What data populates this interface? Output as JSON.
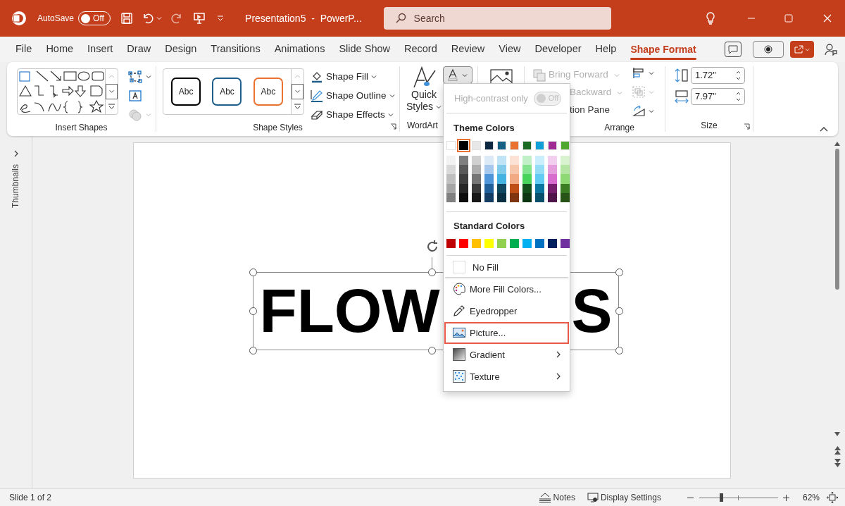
{
  "title_bar": {
    "autosave_label": "AutoSave",
    "autosave_on": false,
    "autosave_state": "Off",
    "document_title": "Presentation5  -  PowerP...",
    "search_placeholder": "Search"
  },
  "ribbon_tabs": [
    {
      "label": "File",
      "selected": false
    },
    {
      "label": "Home",
      "selected": false
    },
    {
      "label": "Insert",
      "selected": false
    },
    {
      "label": "Draw",
      "selected": false
    },
    {
      "label": "Design",
      "selected": false
    },
    {
      "label": "Transitions",
      "selected": false
    },
    {
      "label": "Animations",
      "selected": false
    },
    {
      "label": "Slide Show",
      "selected": false
    },
    {
      "label": "Record",
      "selected": false
    },
    {
      "label": "Review",
      "selected": false
    },
    {
      "label": "View",
      "selected": false
    },
    {
      "label": "Developer",
      "selected": false
    },
    {
      "label": "Help",
      "selected": false
    },
    {
      "label": "Shape Format",
      "selected": true
    }
  ],
  "ribbon": {
    "insert_shapes": {
      "label": "Insert Shapes"
    },
    "shape_styles": {
      "presets": [
        {
          "text": "Abc",
          "color": "#000000"
        },
        {
          "text": "Abc",
          "color": "#1f5f8b"
        },
        {
          "text": "Abc",
          "color": "#e97132"
        }
      ],
      "commands": [
        "Shape Fill",
        "Shape Outline",
        "Shape Effects"
      ],
      "label": "Shape Styles"
    },
    "wordart": {
      "quick_styles": "Quick Styles",
      "label": "WordArt"
    },
    "arrange": {
      "commands": [
        {
          "text": "Bring Forward",
          "disabled": true
        },
        {
          "text": "Backward",
          "disabled": true
        },
        {
          "text": "tion Pane",
          "disabled": false
        }
      ],
      "label": "Arrange"
    },
    "size": {
      "height": "1.72\"",
      "width": "7.97\"",
      "label": "Size"
    }
  },
  "thumbnails_pane": {
    "label": "Thumbnails"
  },
  "slide": {
    "text_left": "FLOW",
    "text_right": "S"
  },
  "fill_menu": {
    "high_contrast": {
      "label": "High-contrast only",
      "state": "Off",
      "on": false,
      "disabled": true
    },
    "theme_heading": "Theme Colors",
    "theme_colors": [
      {
        "color": "#ffffff",
        "selected": false,
        "shades": [
          {
            "color": "#f2f2f2"
          },
          {
            "color": "#d9d9d9"
          },
          {
            "color": "#bfbfbf"
          },
          {
            "color": "#a6a6a6"
          },
          {
            "color": "#808080"
          }
        ]
      },
      {
        "color": "#000000",
        "selected": true,
        "shades": [
          {
            "color": "#7f7f7f"
          },
          {
            "color": "#595959"
          },
          {
            "color": "#3f3f3f"
          },
          {
            "color": "#262626"
          },
          {
            "color": "#0d0d0d"
          }
        ]
      },
      {
        "color": "#e8e8e8",
        "selected": false,
        "shades": [
          {
            "color": "#d0d0d0"
          },
          {
            "color": "#aeaeae"
          },
          {
            "color": "#757575"
          },
          {
            "color": "#3a3a3a"
          },
          {
            "color": "#171717"
          }
        ]
      },
      {
        "color": "#0e2841",
        "selected": false,
        "shades": [
          {
            "color": "#dceaf7"
          },
          {
            "color": "#a6c8ed"
          },
          {
            "color": "#4e95d9"
          },
          {
            "color": "#215f9a"
          },
          {
            "color": "#153d63"
          }
        ]
      },
      {
        "color": "#156082",
        "selected": false,
        "shades": [
          {
            "color": "#c0e4f5"
          },
          {
            "color": "#83cbeb"
          },
          {
            "color": "#44b3e1"
          },
          {
            "color": "#104862"
          },
          {
            "color": "#0b3041"
          }
        ]
      },
      {
        "color": "#e97132",
        "selected": false,
        "shades": [
          {
            "color": "#fbe2d5"
          },
          {
            "color": "#f7c7ac"
          },
          {
            "color": "#f2aa84"
          },
          {
            "color": "#c04f15"
          },
          {
            "color": "#7f3510"
          }
        ]
      },
      {
        "color": "#196b24",
        "selected": false,
        "shades": [
          {
            "color": "#c1f0c8"
          },
          {
            "color": "#83e28e"
          },
          {
            "color": "#47d45a"
          },
          {
            "color": "#12501b"
          },
          {
            "color": "#0c3512"
          }
        ]
      },
      {
        "color": "#0f9ed5",
        "selected": false,
        "shades": [
          {
            "color": "#caeefb"
          },
          {
            "color": "#95dcf7"
          },
          {
            "color": "#61cbf3"
          },
          {
            "color": "#0b76a0"
          },
          {
            "color": "#074f6a"
          }
        ]
      },
      {
        "color": "#a02b93",
        "selected": false,
        "shades": [
          {
            "color": "#f2cfee"
          },
          {
            "color": "#e59edd"
          },
          {
            "color": "#d86dcd"
          },
          {
            "color": "#77206d"
          },
          {
            "color": "#501549"
          }
        ]
      },
      {
        "color": "#4ea72e",
        "selected": false,
        "shades": [
          {
            "color": "#d9f2d0"
          },
          {
            "color": "#b4e5a2"
          },
          {
            "color": "#8ed973"
          },
          {
            "color": "#3b7d23"
          },
          {
            "color": "#275317"
          }
        ]
      }
    ],
    "standard_heading": "Standard Colors",
    "standard_colors": [
      {
        "color": "#c00000"
      },
      {
        "color": "#ff0000"
      },
      {
        "color": "#ffc000"
      },
      {
        "color": "#ffff00"
      },
      {
        "color": "#92d050"
      },
      {
        "color": "#00b050"
      },
      {
        "color": "#00b0f0"
      },
      {
        "color": "#0070c0"
      },
      {
        "color": "#002060"
      },
      {
        "color": "#7030a0"
      }
    ],
    "items": [
      {
        "kind": "no_fill",
        "text": "No Fill",
        "highlighted": false,
        "submenu": false
      },
      {
        "kind": "more_colors",
        "text": "More Fill Colors...",
        "highlighted": false,
        "submenu": false
      },
      {
        "kind": "eyedropper",
        "text": "Eyedropper",
        "highlighted": false,
        "submenu": false
      },
      {
        "kind": "picture",
        "text": "Picture...",
        "highlighted": true,
        "submenu": false
      },
      {
        "kind": "gradient",
        "text": "Gradient",
        "highlighted": false,
        "submenu": true
      },
      {
        "kind": "texture",
        "text": "Texture",
        "highlighted": false,
        "submenu": true
      }
    ]
  },
  "status_bar": {
    "slide_info": "Slide 1 of 2",
    "notes": "Notes",
    "display_settings": "Display Settings",
    "zoom": {
      "level": 0.28,
      "reading": "62%"
    }
  }
}
